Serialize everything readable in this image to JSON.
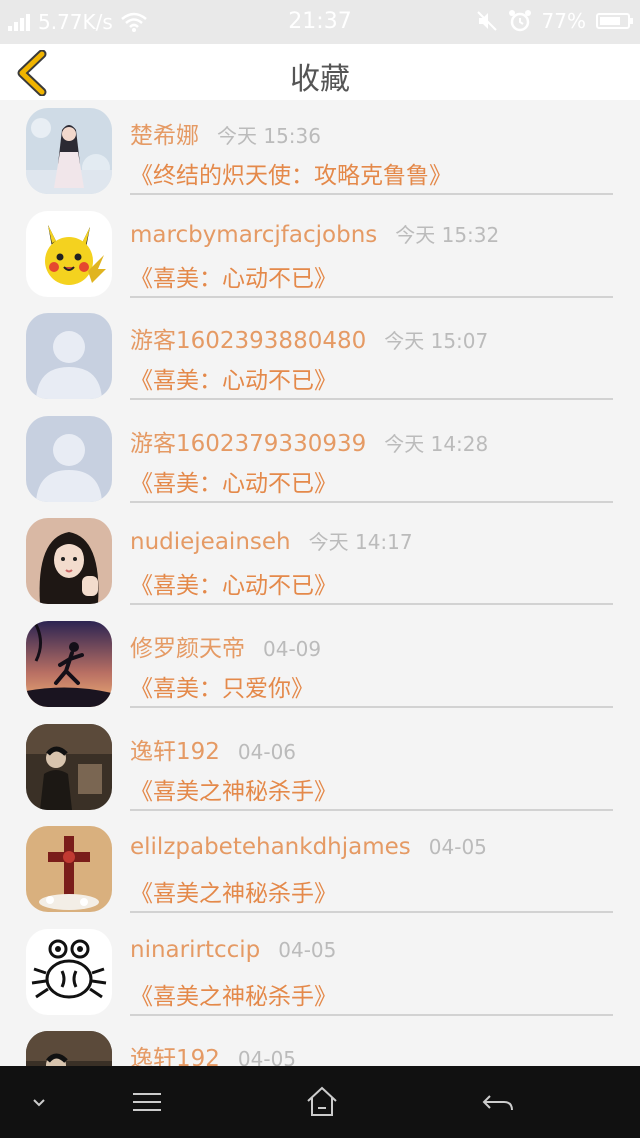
{
  "status_bar": {
    "network_speed": "5.77K/s",
    "time": "21:37",
    "battery": "77%",
    "battery_level": 0.77,
    "icons": [
      "signal-icon",
      "wifi-icon",
      "mute-icon",
      "alarm-icon",
      "battery-icon"
    ]
  },
  "header": {
    "title": "收藏",
    "back_icon": "chevron-left-icon"
  },
  "favorites": [
    {
      "user": "楚希娜",
      "time": "今天 15:36",
      "book": "《终结的炽天使：攻略克鲁鲁》",
      "avatar": "photo-avatar-girl-snow"
    },
    {
      "user": "marcbymarcjfacjobns",
      "time": "今天 15:32",
      "book": "《喜美：心动不已》",
      "avatar": "pikachu-avatar"
    },
    {
      "user": "游客1602393880480",
      "time": "今天 15:07",
      "book": "《喜美：心动不已》",
      "avatar": "default-avatar"
    },
    {
      "user": "游客1602379330939",
      "time": "今天 14:28",
      "book": "《喜美：心动不已》",
      "avatar": "default-avatar"
    },
    {
      "user": "nudiejeainseh",
      "time": "今天 14:17",
      "book": "《喜美：心动不已》",
      "avatar": "photo-avatar-girl"
    },
    {
      "user": "修罗颜天帝",
      "time": "04-09",
      "book": "《喜美：只爱你》",
      "avatar": "running-silhouette-avatar"
    },
    {
      "user": "逸轩192",
      "time": "04-06",
      "book": "《喜美之神秘杀手》",
      "avatar": "dark-photo-avatar"
    },
    {
      "user": "elilzpabetehankdhjames",
      "time": "04-05",
      "book": "《喜美之神秘杀手》",
      "avatar": "cross-avatar"
    },
    {
      "user": "ninarirtccip",
      "time": "04-05",
      "book": "《喜美之神秘杀手》",
      "avatar": "crab-cartoon-avatar"
    },
    {
      "user": "逸轩192",
      "time": "04-05",
      "book": "",
      "avatar": "dark-photo-avatar"
    }
  ],
  "nav_bar": {
    "buttons": [
      "chevron-down-icon",
      "menu-icon",
      "home-icon",
      "back-arrow-icon"
    ]
  },
  "colors": {
    "accent_name": "#e59a64",
    "book_title": "#e4894a",
    "time_text": "#bbbbbb",
    "back_chevron": "#f0b400"
  }
}
